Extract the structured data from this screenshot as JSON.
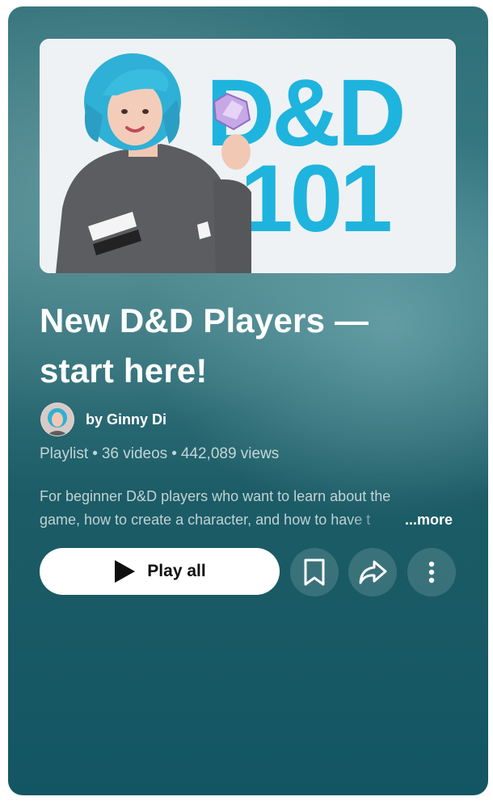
{
  "thumbnail": {
    "text_line1": "D&D",
    "text_line2": "101"
  },
  "playlist": {
    "title_line1": "New D&D Players —",
    "title_line2": "start here!",
    "author": "by Ginny Di",
    "type": "Playlist",
    "video_count": "36 videos",
    "views": "442,089 views",
    "description_line1": "For beginner D&D players who want to learn about the",
    "description_line2": "game, how to create a character, and how to have t",
    "more_label": "...more"
  },
  "actions": {
    "play_all_label": "Play all",
    "save_icon": "bookmark-icon",
    "share_icon": "share-icon",
    "more_icon": "more-vertical-icon"
  },
  "colors": {
    "accent_cyan": "#1fb4de",
    "card_bg": "#1c5c66"
  }
}
